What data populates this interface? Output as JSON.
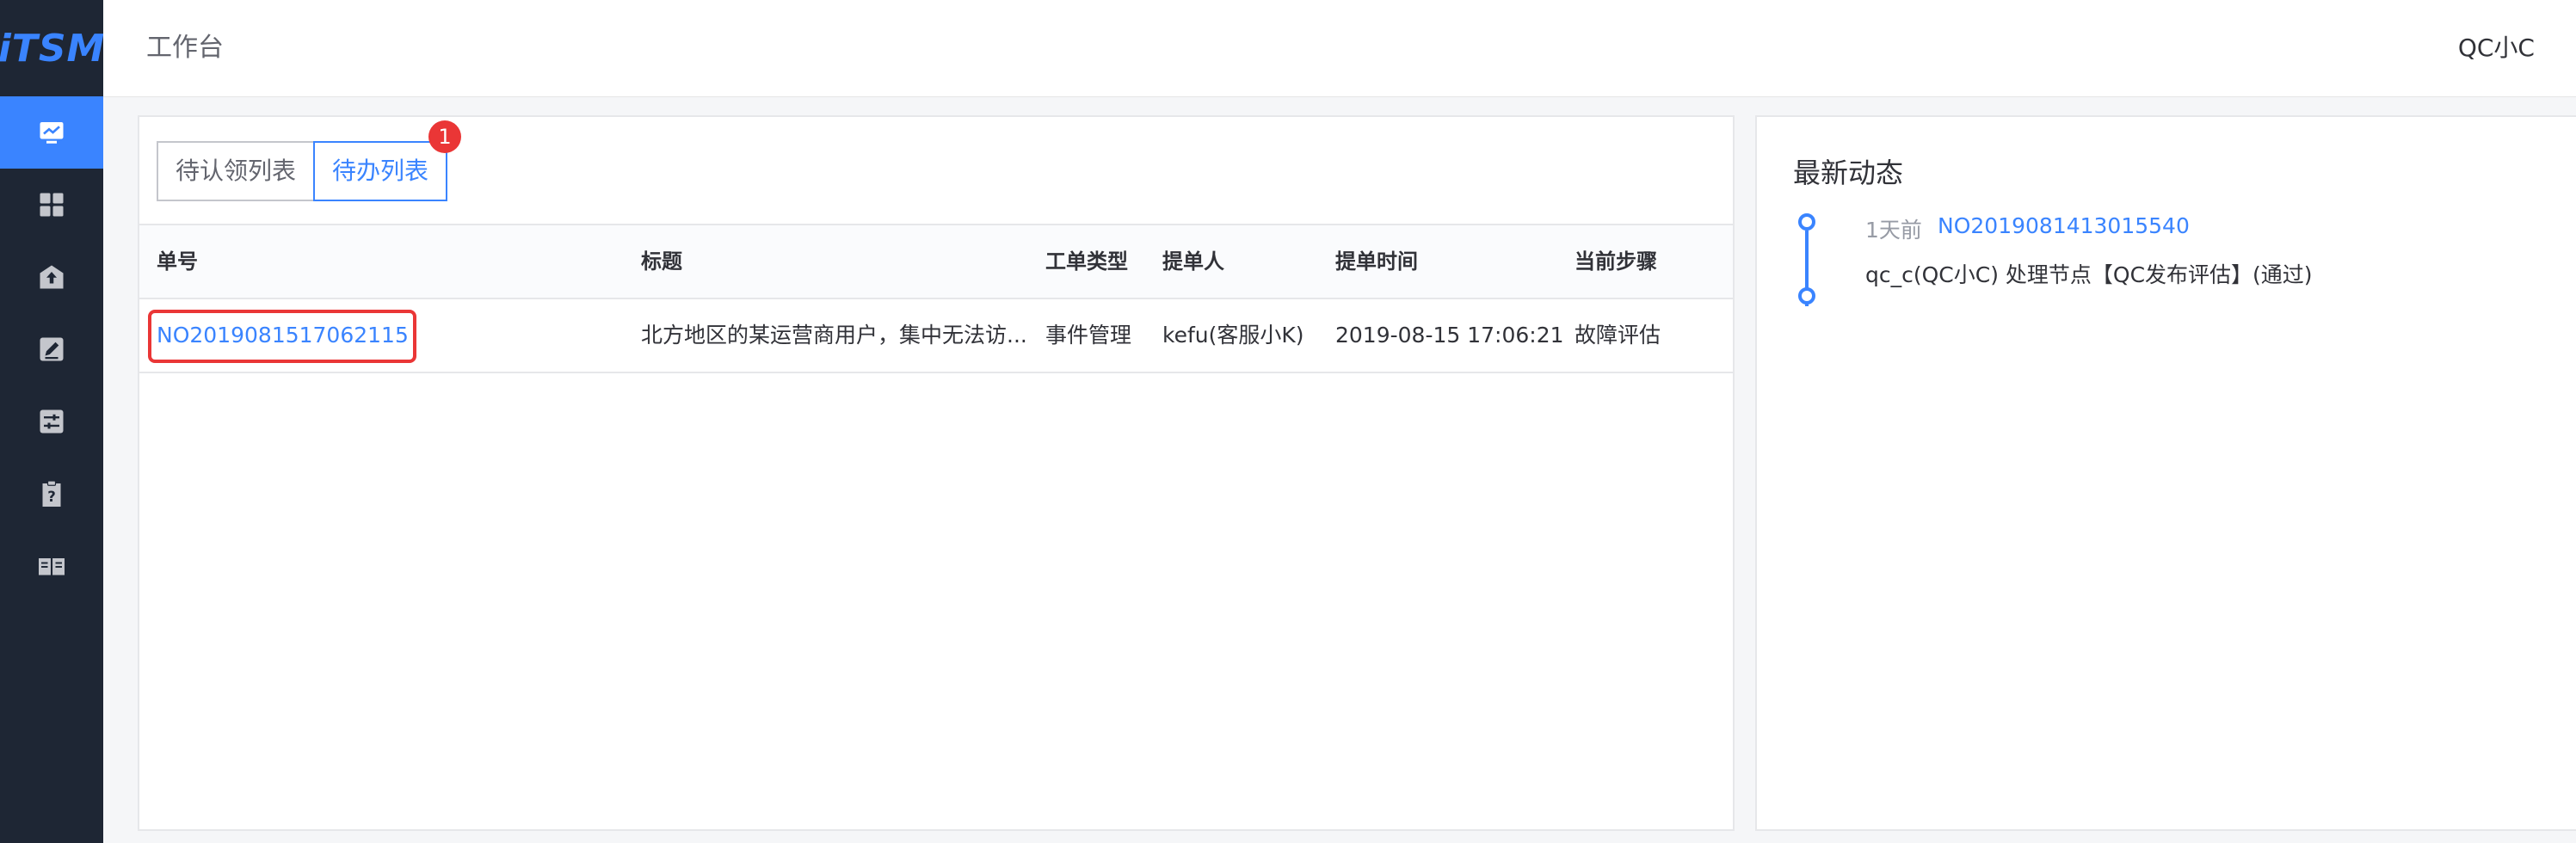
{
  "app": {
    "logo": "iTSM",
    "brand_color": "#3a84ff"
  },
  "header": {
    "title": "工作台",
    "user": "QC小C"
  },
  "sidebar": {
    "items": [
      {
        "icon": "monitor-icon",
        "active": true
      },
      {
        "icon": "grid-icon",
        "active": false
      },
      {
        "icon": "upload-icon",
        "active": false
      },
      {
        "icon": "edit-icon",
        "active": false
      },
      {
        "icon": "sliders-icon",
        "active": false
      },
      {
        "icon": "help-icon",
        "active": false
      },
      {
        "icon": "book-icon",
        "active": false
      }
    ]
  },
  "tabs": [
    {
      "label": "待认领列表",
      "active": false
    },
    {
      "label": "待办列表",
      "active": true,
      "badge": "1"
    }
  ],
  "table": {
    "headers": [
      "单号",
      "标题",
      "工单类型",
      "提单人",
      "提单时间",
      "当前步骤"
    ],
    "rows": [
      [
        "NO2019081517062115",
        "北方地区的某运营商用户，集中无法访...",
        "事件管理",
        "kefu(客服小K)",
        "2019-08-15 17:06:21",
        "故障评估"
      ]
    ]
  },
  "activity": {
    "title": "最新动态",
    "items": [
      {
        "time": "1天前",
        "ticket": "NO2019081413015540",
        "desc": "qc_c(QC小C) 处理节点【QC发布评估】(通过)"
      }
    ]
  }
}
